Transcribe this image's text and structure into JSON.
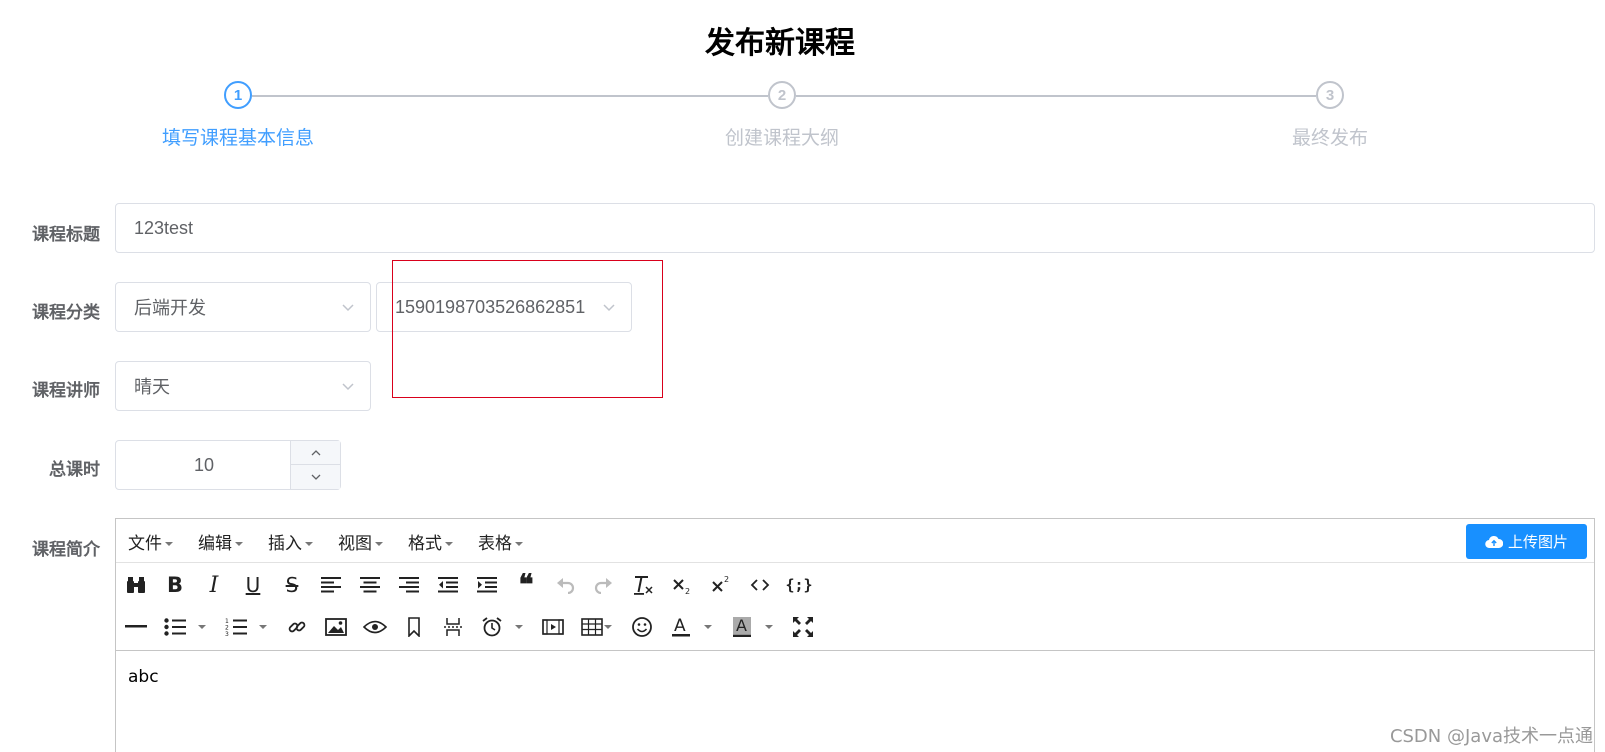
{
  "page_title": "发布新课程",
  "steps": [
    {
      "number": "1",
      "label": "填写课程基本信息",
      "active": true
    },
    {
      "number": "2",
      "label": "创建课程大纲",
      "active": false
    },
    {
      "number": "3",
      "label": "最终发布",
      "active": false
    }
  ],
  "form": {
    "title_label": "课程标题",
    "title_value": "123test",
    "category_label": "课程分类",
    "category_level1": "后端开发",
    "category_level2": "1590198703526862851",
    "teacher_label": "课程讲师",
    "teacher_value": "晴天",
    "lesson_label": "总课时",
    "lesson_value": "10",
    "desc_label": "课程简介"
  },
  "editor": {
    "menus": [
      "文件",
      "编辑",
      "插入",
      "视图",
      "格式",
      "表格"
    ],
    "upload_label": "上传图片",
    "content": "abc",
    "toolbar_icons_row1": [
      "find-icon",
      "bold-icon",
      "italic-icon",
      "underline-icon",
      "strikethrough-icon",
      "align-left-icon",
      "align-center-icon",
      "align-right-icon",
      "outdent-icon",
      "indent-icon",
      "blockquote-icon",
      "undo-icon",
      "redo-icon",
      "clear-format-icon",
      "subscript-icon",
      "superscript-icon",
      "code-icon",
      "code-sample-icon"
    ],
    "toolbar_icons_row2": [
      "horizontal-rule-icon",
      "bullet-list-icon",
      "numbered-list-icon",
      "link-icon",
      "image-icon",
      "preview-icon",
      "bookmark-icon",
      "page-break-icon",
      "datetime-icon",
      "media-icon",
      "table-icon",
      "emoticon-icon",
      "text-color-icon",
      "background-color-icon",
      "fullscreen-icon"
    ]
  },
  "watermark": "CSDN @Java技术一点通",
  "colors": {
    "primary": "#409eff",
    "upload": "#1890ff",
    "inactive": "#c0c4cc",
    "highlight_box": "#d9001b"
  }
}
